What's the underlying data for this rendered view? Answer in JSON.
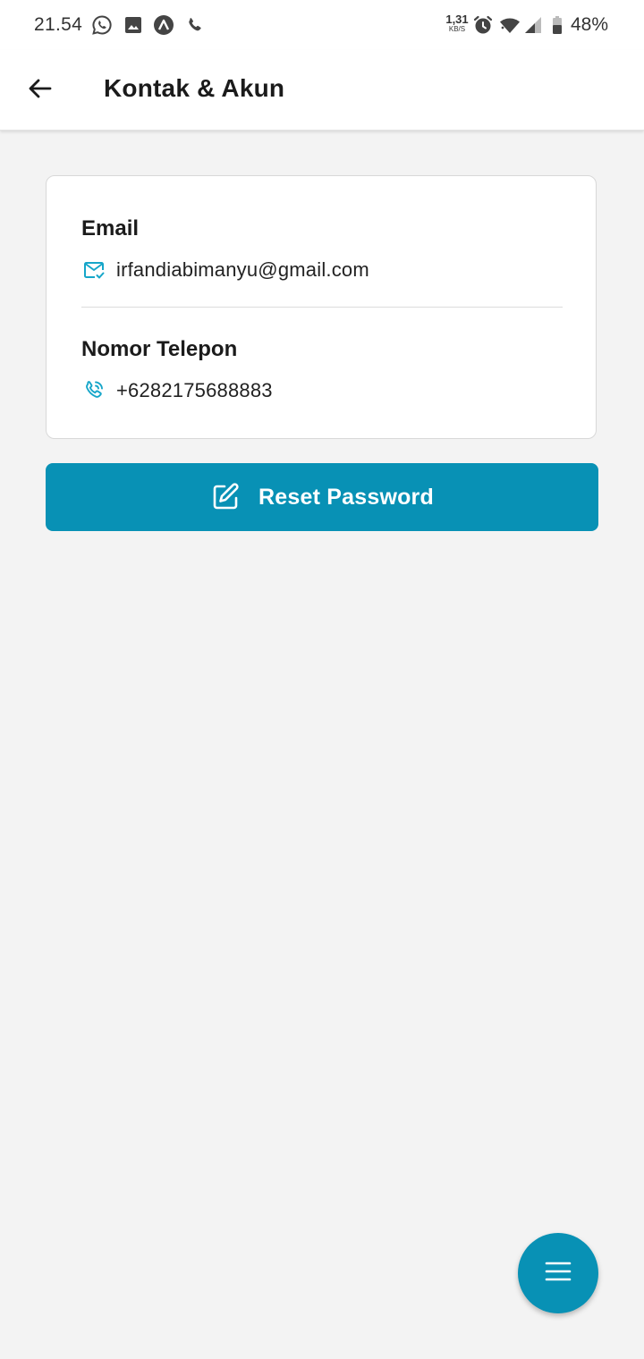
{
  "status_bar": {
    "time": "21.54",
    "net_speed": "1,31",
    "net_speed_unit": "KB/S",
    "battery": "48%",
    "icons": [
      "whatsapp-icon",
      "image-icon",
      "app-notification-icon",
      "phone-call-icon",
      "alarm-icon",
      "wifi-icon",
      "cell-signal-icon",
      "battery-icon"
    ]
  },
  "app_bar": {
    "title": "Kontak & Akun",
    "back_icon": "arrow-left-icon"
  },
  "contact": {
    "email_label": "Email",
    "email_value": "irfandiabimanyu@gmail.com",
    "email_icon": "mail-check-icon",
    "phone_label": "Nomor Telepon",
    "phone_value": "+6282175688883",
    "phone_icon": "phone-icon"
  },
  "actions": {
    "reset_password_label": "Reset Password",
    "reset_icon": "edit-icon"
  },
  "fab": {
    "icon": "menu-icon"
  },
  "colors": {
    "accent": "#0891b5",
    "background": "#f3f3f3",
    "surface": "#ffffff",
    "icon_accent": "#16a6c9"
  }
}
